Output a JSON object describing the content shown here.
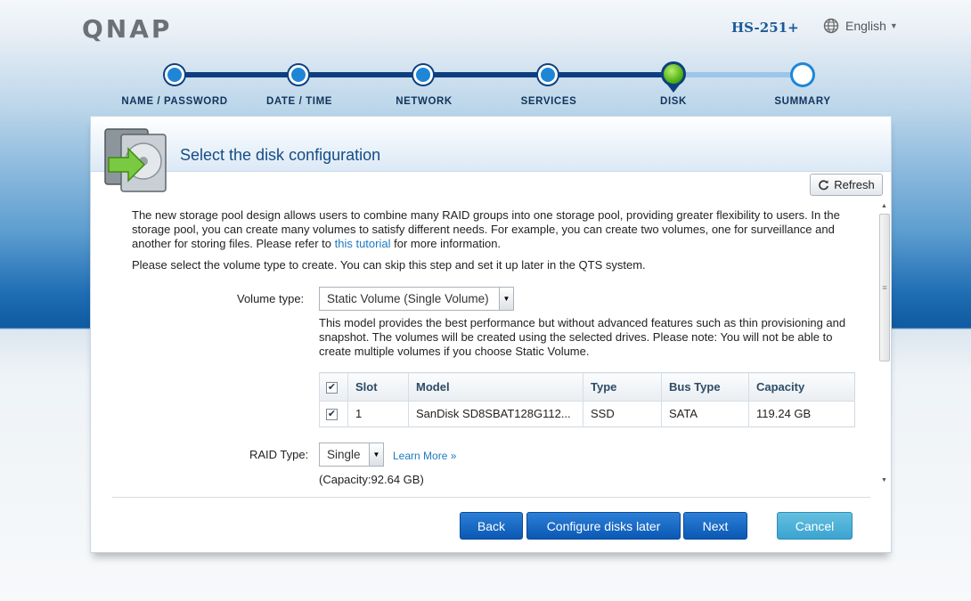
{
  "header": {
    "logo": "QNAP",
    "model": "HS-251+",
    "language": "English"
  },
  "steps": [
    {
      "label": "NAME / PASSWORD"
    },
    {
      "label": "DATE / TIME"
    },
    {
      "label": "NETWORK"
    },
    {
      "label": "SERVICES"
    },
    {
      "label": "DISK"
    },
    {
      "label": "SUMMARY"
    }
  ],
  "panel": {
    "title": "Select the disk configuration",
    "refresh_label": "Refresh",
    "intro_before_link": "The new storage pool design allows users to combine many RAID groups into one storage pool, providing greater flexibility to users. In the storage pool, you can create many volumes to satisfy different needs. For example, you can create two volumes, one for surveillance and another for storing files. Please refer to ",
    "intro_link": "this tutorial",
    "intro_after_link": " for more information.",
    "skip_text": "Please select the volume type to create. You can skip this step and set it up later in the QTS system.",
    "volume_type_label": "Volume type:",
    "volume_type_value": "Static Volume (Single Volume)",
    "volume_description": "This model provides the best performance but without advanced features such as thin provisioning and snapshot. The volumes will be created using the selected drives. Please note: You will not be able to create multiple volumes if you choose Static Volume.",
    "table": {
      "headers": [
        "Slot",
        "Model",
        "Type",
        "Bus Type",
        "Capacity"
      ],
      "rows": [
        {
          "slot": "1",
          "model": "SanDisk SD8SBAT128G112...",
          "type": "SSD",
          "bus": "SATA",
          "capacity": "119.24 GB"
        }
      ]
    },
    "raid_type_label": "RAID Type:",
    "raid_type_value": "Single",
    "learn_more": "Learn More »",
    "capacity_text": "(Capacity:92.64 GB)"
  },
  "buttons": {
    "back": "Back",
    "configure_later": "Configure disks later",
    "next": "Next",
    "cancel": "Cancel"
  },
  "current_step": "DISK"
}
